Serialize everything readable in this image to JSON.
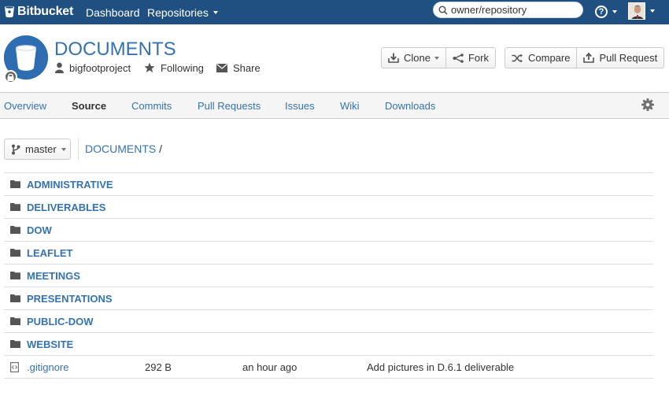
{
  "topbar": {
    "logo_text": "Bitbucket",
    "nav": [
      {
        "label": "Dashboard"
      },
      {
        "label": "Repositories"
      }
    ],
    "search_placeholder": "owner/repository"
  },
  "repo": {
    "title": "DOCUMENTS",
    "owner": "bigfootproject",
    "following_label": "Following",
    "share_label": "Share"
  },
  "actions": {
    "clone": "Clone",
    "fork": "Fork",
    "compare": "Compare",
    "pull_request": "Pull Request"
  },
  "tabs": [
    {
      "label": "Overview"
    },
    {
      "label": "Source",
      "active": true
    },
    {
      "label": "Commits"
    },
    {
      "label": "Pull Requests"
    },
    {
      "label": "Issues"
    },
    {
      "label": "Wiki"
    },
    {
      "label": "Downloads"
    }
  ],
  "branch": {
    "name": "master"
  },
  "breadcrumb": {
    "root": "DOCUMENTS",
    "separator": "/"
  },
  "files": [
    {
      "name": "ADMINISTRATIVE",
      "type": "folder-icon"
    },
    {
      "name": "DELIVERABLES",
      "type": "folder-icon"
    },
    {
      "name": "DOW",
      "type": "folder-icon"
    },
    {
      "name": "LEAFLET",
      "type": "folder-icon"
    },
    {
      "name": "MEETINGS",
      "type": "folder-icon"
    },
    {
      "name": "PRESENTATIONS",
      "type": "folder-icon"
    },
    {
      "name": "PUBLIC-DOW",
      "type": "folder-icon"
    },
    {
      "name": "WEBSITE",
      "type": "folder-icon"
    },
    {
      "name": ".gitignore",
      "type": "file-code-icon",
      "size": "292 B",
      "time": "an hour ago",
      "message": "Add pictures in D.6.1 deliverable"
    }
  ],
  "colors": {
    "topbar": "#205081",
    "link": "#3572b0",
    "repo_avatar": "#2f6db3"
  }
}
